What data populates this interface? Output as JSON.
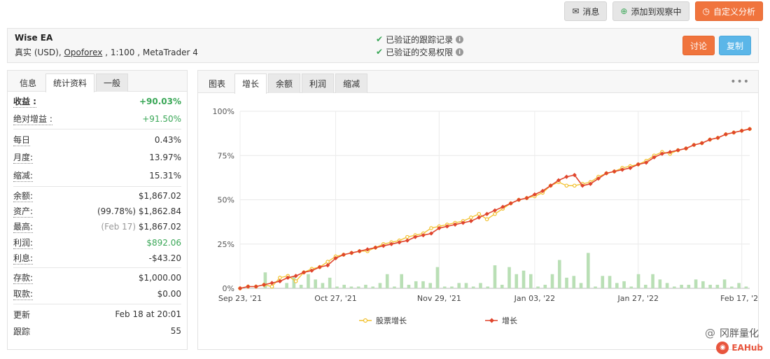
{
  "top_actions": {
    "messages": "消息",
    "add_watch": "添加到观察中",
    "custom_analysis": "自定义分析"
  },
  "header": {
    "title": "Wise EA",
    "account_type": "真实 (USD), ",
    "broker": "Opoforex",
    "rest": " , 1:100 , MetaTrader 4",
    "verified_track": "已验证的跟踪记录",
    "verified_trading": "已验证的交易权限",
    "discuss": "讨论",
    "copy": "复制"
  },
  "left_tabs": [
    "信息",
    "统计资料",
    "一般"
  ],
  "stats": {
    "gain_label": "收益 :",
    "gain_value": "+90.03%",
    "abs_gain_label": "绝对增益 :",
    "abs_gain_value": "+91.50%",
    "daily_label": "每日",
    "daily_value": "0.43%",
    "monthly_label": "月度:",
    "monthly_value": "13.97%",
    "drawdown_label": "缩减:",
    "drawdown_value": "15.31%",
    "balance_label": "余额:",
    "balance_value": "$1,867.02",
    "equity_label": "资产:",
    "equity_pct": "(99.78%)",
    "equity_value": "$1,862.84",
    "highest_label": "最高:",
    "highest_date": "(Feb 17)",
    "highest_value": "$1,867.02",
    "profit_label": "利润:",
    "profit_value": "$892.06",
    "interest_label": "利息:",
    "interest_value": "-$43.20",
    "deposits_label": "存款:",
    "deposits_value": "$1,000.00",
    "withdrawals_label": "取款:",
    "withdrawals_value": "$0.00",
    "updated_label": "更新",
    "updated_value": "Feb 18 at 20:01",
    "tracking_label": "跟踪",
    "tracking_value": "55"
  },
  "right_tabs": [
    "图表",
    "增长",
    "余额",
    "利润",
    "缩减"
  ],
  "colors": {
    "growth": "#e0452d",
    "equity": "#f2c12e",
    "bars": "#b9dfb5",
    "orange": "#f0743d",
    "blue": "#5bb6e8",
    "green": "#3aa757"
  },
  "watermark": {
    "name": "冈胖量化",
    "logo_text": "EAHub"
  },
  "chart_data": {
    "type": "line",
    "y_ticks": [
      "100%",
      "75%",
      "50%",
      "25%",
      "0%"
    ],
    "ylim": [
      0,
      100
    ],
    "x_tick_labels": [
      "Sep 23, '21",
      "Oct 27, '21",
      "Nov 29, '21",
      "Jan 03, '22",
      "Jan 27, '22",
      "Feb 17, '22"
    ],
    "x_tick_indices": [
      0,
      12,
      25,
      37,
      50,
      63
    ],
    "grid": true,
    "legend_position": "bottom",
    "series": [
      {
        "name": "股票增长",
        "color": "#f2c12e",
        "values": [
          0,
          1,
          1,
          2,
          1,
          6,
          7,
          4,
          9,
          11,
          12,
          15,
          18,
          19,
          20,
          21,
          21,
          23,
          25,
          26,
          27,
          29,
          30,
          31,
          34,
          35,
          36,
          37,
          38,
          40,
          42,
          39,
          42,
          45,
          48,
          50,
          51,
          52,
          54,
          58,
          60,
          58,
          58,
          59,
          60,
          63,
          65,
          66,
          68,
          69,
          70,
          72,
          75,
          77,
          76,
          78,
          79,
          81,
          82,
          84,
          85,
          87,
          88,
          89,
          90
        ]
      },
      {
        "name": "增长",
        "color": "#e0452d",
        "values": [
          0,
          1,
          1,
          2,
          3,
          4,
          6,
          7,
          9,
          10,
          12,
          13,
          17,
          19,
          20,
          21,
          22,
          23,
          24,
          25,
          26,
          27,
          29,
          30,
          31,
          34,
          35,
          36,
          37,
          38,
          40,
          42,
          44,
          46,
          48,
          50,
          51,
          53,
          55,
          58,
          61,
          63,
          64,
          58,
          59,
          62,
          65,
          66,
          67,
          68,
          70,
          71,
          74,
          76,
          77,
          78,
          79,
          81,
          82,
          84,
          85,
          87,
          88,
          89,
          90
        ]
      }
    ],
    "bars": [
      0,
      0,
      0,
      9,
      1,
      0,
      3,
      7,
      2,
      8,
      5,
      3,
      6,
      1,
      2,
      1,
      1,
      2,
      1,
      3,
      8,
      1,
      8,
      2,
      4,
      4,
      3,
      12,
      1,
      1,
      3,
      3,
      1,
      3,
      1,
      13,
      2,
      12,
      8,
      10,
      8,
      1,
      2,
      8,
      16,
      6,
      7,
      3,
      20,
      1,
      7,
      7,
      3,
      4,
      1,
      8,
      2,
      8,
      5,
      3,
      1,
      2,
      2,
      5,
      4,
      2,
      2,
      5,
      1,
      3,
      1
    ]
  }
}
